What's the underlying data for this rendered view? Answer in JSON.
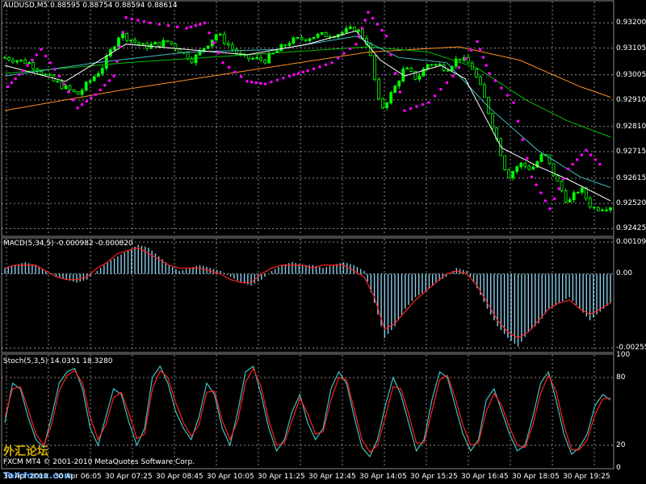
{
  "header": {
    "symbol_line": "AUDUSD,M5  0.88595 0.88754 0.88594 0.88614"
  },
  "indicators": {
    "macd_title": "MACD(5,34,5) -0.000982 -0.000820",
    "stoch_title": "Stoch(5,3,5) 14.0351 18.3280"
  },
  "footer": {
    "copyright": "FXCM MT4 © 2001-2010 MetaQuotes Software Corp.",
    "watermark": "外汇论坛",
    "site": "Talkforex.com"
  },
  "colors": {
    "background": "#000000",
    "grid": "#8a8a8a",
    "panel_border": "#8a8a8a",
    "bull_candle": "#00ff00",
    "bear_candle": "#000000",
    "sar": "#ff00ff",
    "ma_fast": "#ffffff",
    "ma_mid": "#40c0c0",
    "ma_slow": "#00c000",
    "ma_long": "#ff9020",
    "macd_hist": "#87ceeb",
    "macd_signal": "#ff2020",
    "stoch_main": "#40c0c0",
    "stoch_signal": "#ff2020"
  },
  "chart_data": [
    {
      "type": "candlestick",
      "title": "AUDUSD,M5  0.88595 0.88754 0.88594 0.88614",
      "y_ticks": [
        "0.93200",
        "0.93105",
        "0.93005",
        "0.92910",
        "0.92810",
        "0.92715",
        "0.92615",
        "0.92520",
        "0.92425"
      ],
      "ylim": [
        0.92405,
        0.93262
      ],
      "x_ticks": [
        "30 Apr 2010",
        "30 Apr 06:05",
        "30 Apr 07:25",
        "30 Apr 08:45",
        "30 Apr 10:05",
        "30 Apr 11:25",
        "30 Apr 12:45",
        "30 Apr 14:05",
        "30 Apr 15:25",
        "30 Apr 16:45",
        "30 Apr 18:05",
        "30 Apr 19:25"
      ],
      "grid": true,
      "close_points": [
        [
          0,
          0.9307
        ],
        [
          0.04,
          0.9305
        ],
        [
          0.08,
          0.9298
        ],
        [
          0.12,
          0.9293
        ],
        [
          0.16,
          0.9303
        ],
        [
          0.19,
          0.9316
        ],
        [
          0.23,
          0.9311
        ],
        [
          0.27,
          0.9313
        ],
        [
          0.31,
          0.9306
        ],
        [
          0.35,
          0.9316
        ],
        [
          0.39,
          0.9307
        ],
        [
          0.43,
          0.9306
        ],
        [
          0.47,
          0.9313
        ],
        [
          0.51,
          0.9315
        ],
        [
          0.55,
          0.9316
        ],
        [
          0.58,
          0.9318
        ],
        [
          0.6,
          0.9312
        ],
        [
          0.62,
          0.9287
        ],
        [
          0.64,
          0.9294
        ],
        [
          0.66,
          0.9303
        ],
        [
          0.68,
          0.9299
        ],
        [
          0.7,
          0.9305
        ],
        [
          0.73,
          0.9303
        ],
        [
          0.75,
          0.9307
        ],
        [
          0.77,
          0.9304
        ],
        [
          0.79,
          0.9293
        ],
        [
          0.81,
          0.9278
        ],
        [
          0.83,
          0.9262
        ],
        [
          0.85,
          0.9267
        ],
        [
          0.87,
          0.9265
        ],
        [
          0.89,
          0.9271
        ],
        [
          0.91,
          0.9261
        ],
        [
          0.93,
          0.9252
        ],
        [
          0.95,
          0.9258
        ],
        [
          0.97,
          0.925
        ],
        [
          1.0,
          0.9251
        ]
      ],
      "ma_white": [
        [
          0,
          0.9304
        ],
        [
          0.1,
          0.9298
        ],
        [
          0.2,
          0.9312
        ],
        [
          0.3,
          0.931
        ],
        [
          0.4,
          0.9308
        ],
        [
          0.5,
          0.9312
        ],
        [
          0.58,
          0.9317
        ],
        [
          0.62,
          0.9306
        ],
        [
          0.66,
          0.93
        ],
        [
          0.72,
          0.9304
        ],
        [
          0.76,
          0.9299
        ],
        [
          0.82,
          0.9273
        ],
        [
          0.88,
          0.9266
        ],
        [
          0.93,
          0.9261
        ],
        [
          1.0,
          0.9253
        ]
      ],
      "ma_cyan": [
        [
          0,
          0.93
        ],
        [
          0.15,
          0.9305
        ],
        [
          0.3,
          0.9309
        ],
        [
          0.45,
          0.931
        ],
        [
          0.58,
          0.9315
        ],
        [
          0.65,
          0.9307
        ],
        [
          0.73,
          0.9305
        ],
        [
          0.8,
          0.9288
        ],
        [
          0.88,
          0.9272
        ],
        [
          0.95,
          0.9262
        ],
        [
          1.0,
          0.9258
        ]
      ],
      "ma_green": [
        [
          0,
          0.9301
        ],
        [
          0.2,
          0.9305
        ],
        [
          0.4,
          0.9308
        ],
        [
          0.6,
          0.9311
        ],
        [
          0.7,
          0.9309
        ],
        [
          0.78,
          0.9303
        ],
        [
          0.86,
          0.9291
        ],
        [
          0.93,
          0.9283
        ],
        [
          1.0,
          0.9277
        ]
      ],
      "ma_orange": [
        [
          0,
          0.9287
        ],
        [
          0.2,
          0.9295
        ],
        [
          0.4,
          0.9302
        ],
        [
          0.6,
          0.9309
        ],
        [
          0.75,
          0.9311
        ],
        [
          0.85,
          0.9306
        ],
        [
          0.95,
          0.9296
        ],
        [
          1.0,
          0.9292
        ]
      ],
      "sar": [
        [
          0.005,
          0.9296
        ],
        [
          0.03,
          0.9302
        ],
        [
          0.06,
          0.931
        ],
        [
          0.09,
          0.93
        ],
        [
          0.12,
          0.9288
        ],
        [
          0.15,
          0.9293
        ],
        [
          0.18,
          0.93
        ],
        [
          0.2,
          0.9322
        ],
        [
          0.24,
          0.932
        ],
        [
          0.3,
          0.9318
        ],
        [
          0.33,
          0.932
        ],
        [
          0.36,
          0.9305
        ],
        [
          0.4,
          0.9298
        ],
        [
          0.43,
          0.9297
        ],
        [
          0.47,
          0.93
        ],
        [
          0.5,
          0.9302
        ],
        [
          0.54,
          0.9305
        ],
        [
          0.58,
          0.9312
        ],
        [
          0.6,
          0.9324
        ],
        [
          0.63,
          0.9315
        ],
        [
          0.66,
          0.9287
        ],
        [
          0.7,
          0.929
        ],
        [
          0.74,
          0.93
        ],
        [
          0.78,
          0.9313
        ],
        [
          0.8,
          0.9301
        ],
        [
          0.84,
          0.929
        ],
        [
          0.87,
          0.9262
        ],
        [
          0.9,
          0.925
        ],
        [
          0.93,
          0.9265
        ],
        [
          0.96,
          0.9272
        ],
        [
          0.99,
          0.9265
        ]
      ]
    },
    {
      "type": "bar",
      "title": "MACD(5,34,5) -0.000982 -0.000820",
      "y_ticks": [
        "0.001091",
        "0.00",
        "-0.00255"
      ],
      "ylim": [
        -0.00265,
        0.00115
      ],
      "series": [
        {
          "values": [
            0.0002,
            0.0003,
            0.0004,
            0.0003,
            0.0001,
            -0.0001,
            -0.0002,
            -0.0003,
            -0.0002,
            0.0001,
            0.0004,
            0.0006,
            0.0008,
            0.001,
            0.0009,
            0.0006,
            0.0003,
            0.0001,
            0.0002,
            0.0003,
            0.0002,
            0.0001,
            -0.0001,
            -0.0003,
            -0.0004,
            -0.0002,
            0.0001,
            0.0003,
            0.0004,
            0.0003,
            0.0003,
            0.0002,
            0.0003,
            0.0004,
            0.0003,
            0.0001,
            -0.001,
            -0.0022,
            -0.0018,
            -0.0012,
            -0.0008,
            -0.0006,
            -0.0003,
            -0.0001,
            0.0002,
            0.0001,
            -0.0005,
            -0.0012,
            -0.0018,
            -0.0022,
            -0.0025,
            -0.002,
            -0.0017,
            -0.0012,
            -0.001,
            -0.0008,
            -0.0012,
            -0.0016,
            -0.0013,
            -0.001
          ]
        },
        {
          "values": [
            0.0002,
            0.0003,
            0.0003,
            0.0003,
            0.0001,
            -0.0001,
            -0.0002,
            -0.0002,
            -0.0001,
            0.0002,
            0.0004,
            0.0007,
            0.0008,
            0.0009,
            0.0007,
            0.0005,
            0.0003,
            0.0002,
            0.0002,
            0.0002,
            0.0001,
            0.0,
            -0.0002,
            -0.0003,
            -0.0003,
            0.0,
            0.0002,
            0.0003,
            0.0003,
            0.0003,
            0.0002,
            0.0003,
            0.0003,
            0.0003,
            0.0001,
            -0.0001,
            -0.0008,
            -0.0019,
            -0.0017,
            -0.0013,
            -0.0009,
            -0.0006,
            -0.0003,
            0.0,
            0.0001,
            0.0,
            -0.0004,
            -0.001,
            -0.0016,
            -0.002,
            -0.0022,
            -0.002,
            -0.0016,
            -0.0012,
            -0.001,
            -0.0009,
            -0.0012,
            -0.0014,
            -0.0012,
            -0.001
          ]
        }
      ]
    },
    {
      "type": "line",
      "title": "Stoch(5,3,5) 14.0351 18.3280",
      "y_ticks": [
        "100",
        "80",
        "20",
        "0"
      ],
      "ylim": [
        0,
        100
      ],
      "series": [
        {
          "values": [
            40,
            75,
            70,
            45,
            25,
            18,
            45,
            75,
            85,
            88,
            70,
            35,
            20,
            45,
            70,
            65,
            40,
            20,
            35,
            80,
            90,
            75,
            50,
            35,
            25,
            45,
            75,
            65,
            35,
            20,
            50,
            85,
            90,
            65,
            35,
            15,
            25,
            50,
            65,
            40,
            25,
            35,
            70,
            85,
            75,
            45,
            18,
            10,
            25,
            55,
            80,
            65,
            40,
            15,
            25,
            60,
            85,
            80,
            55,
            30,
            15,
            25,
            60,
            70,
            50,
            30,
            15,
            20,
            45,
            75,
            85,
            60,
            30,
            12,
            18,
            30,
            55,
            65,
            60
          ]
        },
        {
          "values": [
            45,
            70,
            72,
            52,
            30,
            20,
            38,
            68,
            82,
            86,
            75,
            45,
            25,
            38,
            62,
            67,
            48,
            26,
            30,
            70,
            86,
            80,
            58,
            40,
            28,
            38,
            67,
            68,
            42,
            25,
            42,
            76,
            88,
            72,
            42,
            20,
            22,
            42,
            62,
            48,
            30,
            32,
            60,
            80,
            78,
            52,
            25,
            14,
            20,
            45,
            72,
            70,
            48,
            22,
            22,
            50,
            78,
            82,
            62,
            38,
            20,
            22,
            50,
            66,
            55,
            36,
            20,
            18,
            38,
            66,
            82,
            68,
            38,
            16,
            16,
            25,
            47,
            61,
            62
          ]
        }
      ]
    }
  ]
}
